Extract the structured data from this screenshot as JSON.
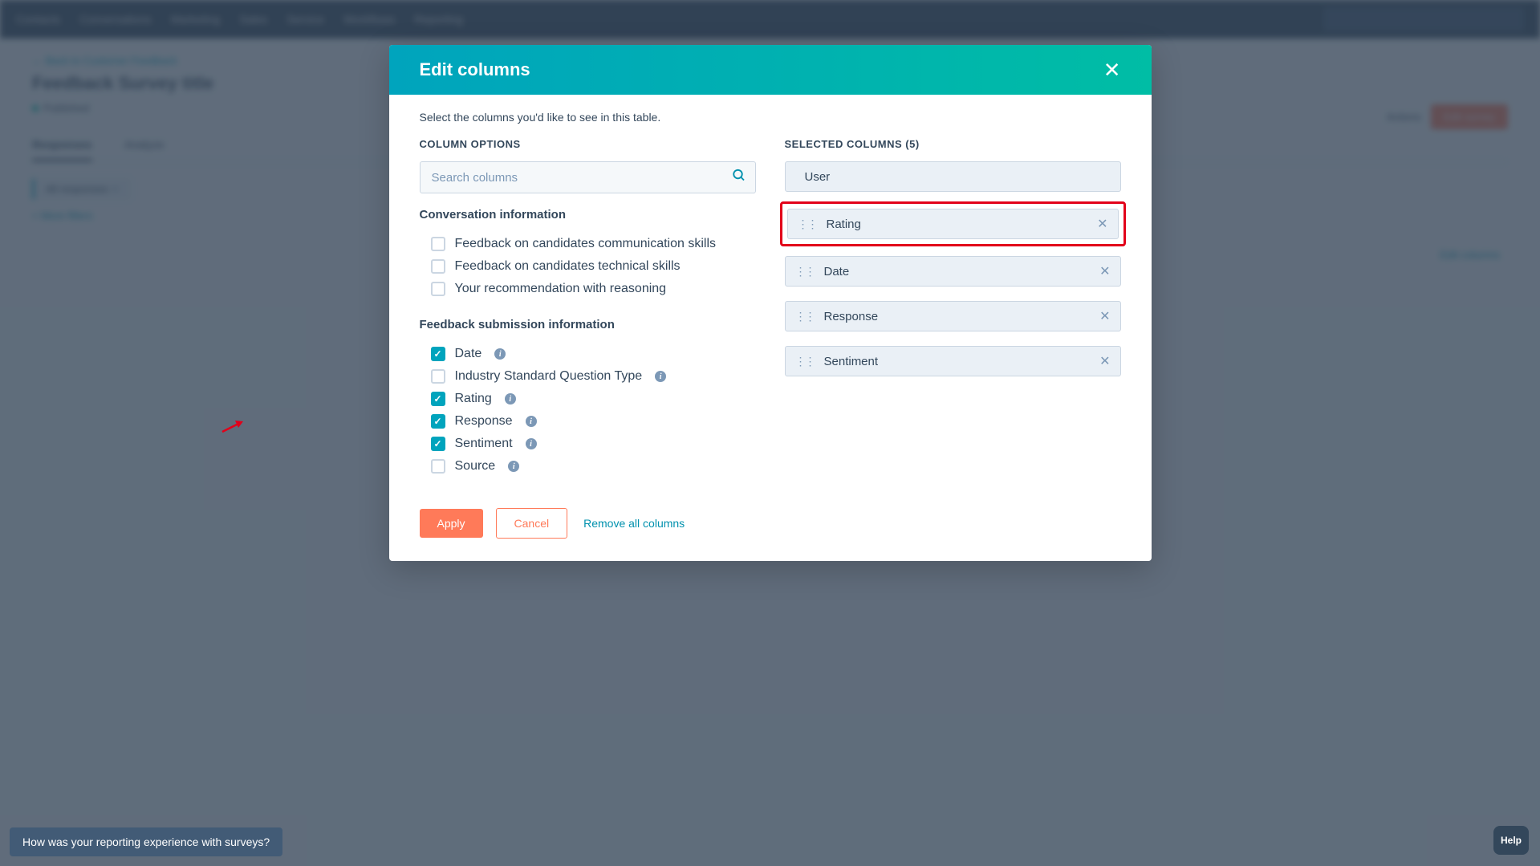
{
  "bg": {
    "nav": [
      "Contacts",
      "Conversations",
      "Marketing",
      "Sales",
      "Service",
      "Workflows",
      "Reporting"
    ],
    "back": "← Back to Customer Feedback",
    "title": "Feedback Survey title",
    "status": "Published",
    "tabs": [
      "Responses",
      "Analyze"
    ],
    "pill": "All responses",
    "more": "+ More filters",
    "actions": "Actions",
    "edit_survey": "Edit survey",
    "edit_columns": "Edit columns"
  },
  "modal": {
    "title": "Edit columns",
    "subtitle": "Select the columns you'd like to see in this table.",
    "left_heading": "COLUMN OPTIONS",
    "right_heading": "SELECTED COLUMNS (5)",
    "search_placeholder": "Search columns",
    "groups": [
      {
        "title": "Conversation information",
        "options": [
          {
            "label": "Feedback on candidates communication skills",
            "checked": false,
            "info": false
          },
          {
            "label": "Feedback on candidates technical skills",
            "checked": false,
            "info": false
          },
          {
            "label": "Your recommendation with reasoning",
            "checked": false,
            "info": false
          }
        ]
      },
      {
        "title": "Feedback submission information",
        "options": [
          {
            "label": "Date",
            "checked": true,
            "info": true
          },
          {
            "label": "Industry Standard Question Type",
            "checked": false,
            "info": true
          },
          {
            "label": "Rating",
            "checked": true,
            "info": true
          },
          {
            "label": "Response",
            "checked": true,
            "info": true
          },
          {
            "label": "Sentiment",
            "checked": true,
            "info": true
          },
          {
            "label": "Source",
            "checked": false,
            "info": true
          }
        ]
      }
    ],
    "selected": [
      {
        "label": "User",
        "locked": true,
        "highlight": false
      },
      {
        "label": "Rating",
        "locked": false,
        "highlight": true
      },
      {
        "label": "Date",
        "locked": false,
        "highlight": false
      },
      {
        "label": "Response",
        "locked": false,
        "highlight": false
      },
      {
        "label": "Sentiment",
        "locked": false,
        "highlight": false
      }
    ],
    "apply": "Apply",
    "cancel": "Cancel",
    "remove_all": "Remove all columns"
  },
  "feedback_bar": "How was your reporting experience with surveys?",
  "help": "Help"
}
